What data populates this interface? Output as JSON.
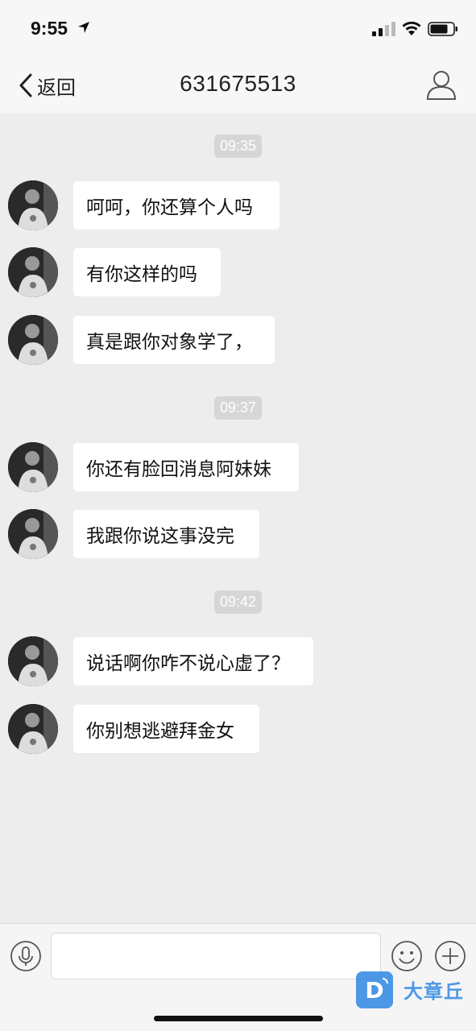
{
  "status_bar": {
    "time": "9:55",
    "icons": [
      "location-arrow-icon",
      "cellular-signal-icon",
      "wifi-icon",
      "battery-icon"
    ]
  },
  "nav": {
    "back_label": "返回",
    "title": "631675513",
    "back_icon": "chevron-left-icon",
    "profile_icon": "person-icon"
  },
  "chat": {
    "groups": [
      {
        "time": "09:35",
        "messages": [
          "呵呵，你还算个人吗",
          "有你这样的吗",
          "真是跟你对象学了，"
        ]
      },
      {
        "time": "09:37",
        "messages": [
          "你还有脸回消息阿妹妹",
          "我跟你说这事没完"
        ]
      },
      {
        "time": "09:42",
        "messages": [
          "说话啊你咋不说心虚了？",
          "你别想逃避拜金女"
        ]
      }
    ]
  },
  "input_bar": {
    "text_value": "",
    "voice_icon": "microphone-icon",
    "emoji_icon": "smiley-face-icon",
    "plus_icon": "plus-circle-icon"
  },
  "watermark": {
    "text": "大章丘",
    "logo_letter": "D"
  },
  "colors": {
    "background": "#ededed",
    "bubble": "#ffffff",
    "timestamp_bg": "#d6d6d6",
    "watermark": "#3a8ee6"
  }
}
